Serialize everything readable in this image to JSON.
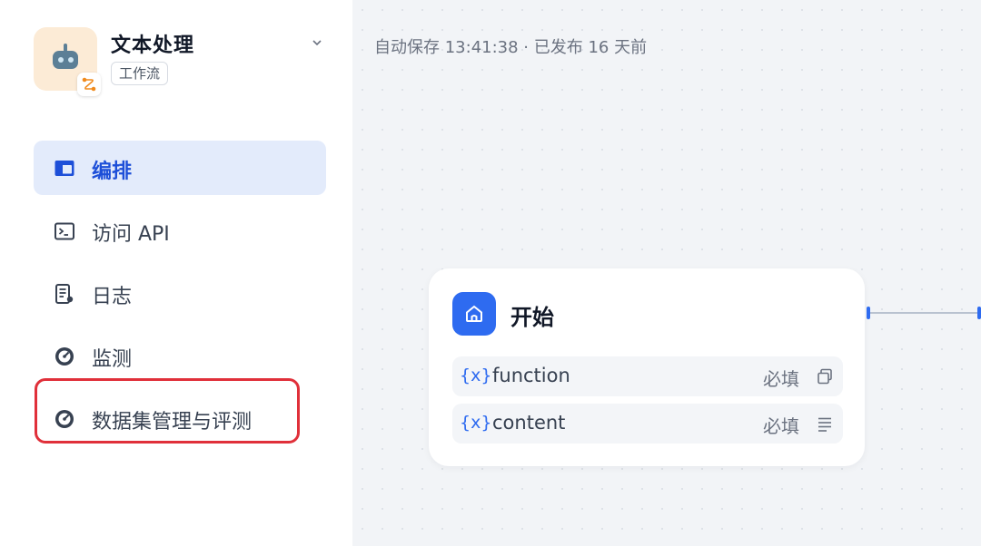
{
  "app": {
    "title": "文本处理",
    "tag": "工作流"
  },
  "nav": {
    "items": [
      {
        "label": "编排",
        "icon": "layout-icon",
        "active": true
      },
      {
        "label": "访问 API",
        "icon": "terminal-icon",
        "active": false
      },
      {
        "label": "日志",
        "icon": "log-icon",
        "active": false
      },
      {
        "label": "监测",
        "icon": "gauge-icon",
        "active": false
      },
      {
        "label": "数据集管理与评测",
        "icon": "gauge-icon",
        "active": false
      }
    ]
  },
  "canvas": {
    "save_status": "自动保存 13:41:38 · 已发布 16 天前",
    "node": {
      "title": "开始",
      "variables": [
        {
          "prefix": "{x}",
          "name": "function",
          "required": "必填",
          "type_icon": "copy-icon"
        },
        {
          "prefix": "{x}",
          "name": "content",
          "required": "必填",
          "type_icon": "text-lines-icon"
        }
      ]
    }
  },
  "colors": {
    "accent": "#2e6bf0",
    "active_nav_bg": "#e3ebfb",
    "highlight": "#e0303a"
  }
}
